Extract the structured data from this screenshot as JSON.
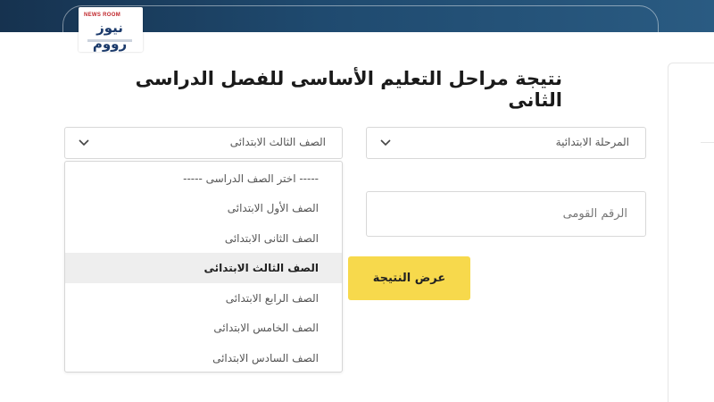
{
  "logo": {
    "small_text": "NEWS ROOM",
    "main_text": "نيوز رووم"
  },
  "page": {
    "title": "نتيجة مراحل التعليم الأساسى للفصل الدراسى الثانى"
  },
  "form": {
    "stage_select": {
      "value": "المرحلة الابتدائية"
    },
    "grade_select": {
      "value": "الصف الثالث الابتدائى",
      "options": [
        "----- اختر الصف الدراسى -----",
        "الصف الأول الابتدائى",
        "الصف الثانى الابتدائى",
        "الصف الثالث الابتدائى",
        "الصف الرابع الابتدائى",
        "الصف الخامس الابتدائى",
        "الصف السادس الابتدائى"
      ],
      "highlighted_index": 3
    },
    "national_id": {
      "placeholder": "الرقم القومى"
    },
    "submit_label": "عرض النتيجة"
  },
  "colors": {
    "banner": "#1f4a6f",
    "button": "#f7d94c"
  },
  "icons": {
    "select_chevron": "chevron-down-icon"
  }
}
